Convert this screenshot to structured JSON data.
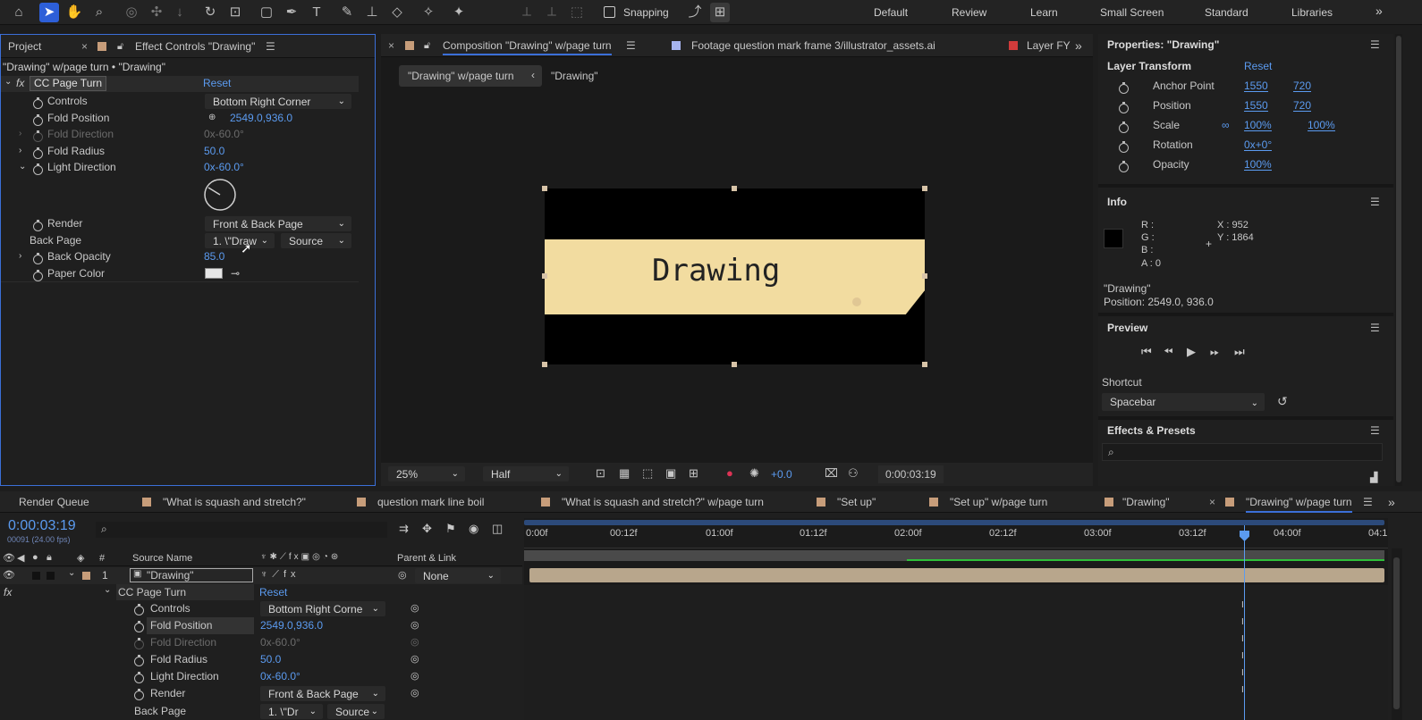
{
  "toolbar": {
    "snapping": "Snapping",
    "workspaces": [
      "Default",
      "Review",
      "Learn",
      "Small Screen",
      "Standard",
      "Libraries"
    ],
    "more": "»"
  },
  "left_panel": {
    "tab_project": "Project",
    "tab_effect": "Effect Controls \"Drawing\"",
    "breadcrumb": "\"Drawing\" w/page turn • \"Drawing\"",
    "fx": "fx",
    "effect_name": "CC Page Turn",
    "reset": "Reset",
    "rows": [
      {
        "label": "Controls",
        "value": "Bottom Right Corner",
        "kind": "dropdown"
      },
      {
        "label": "Fold Position",
        "value": "2549.0,936.0",
        "kind": "point"
      },
      {
        "label": "Fold Direction",
        "value": "0x-60.0°",
        "kind": "disabled"
      },
      {
        "label": "Fold Radius",
        "value": "50.0",
        "kind": "value"
      },
      {
        "label": "Light Direction",
        "value": "0x-60.0°",
        "kind": "value"
      },
      {
        "label": "Render",
        "value": "Front & Back Page",
        "kind": "dropdown"
      },
      {
        "label": "Back Page",
        "value": "1. \\\"Draw",
        "value2": "Source",
        "kind": "dual"
      },
      {
        "label": "Back Opacity",
        "value": "85.0",
        "kind": "value"
      },
      {
        "label": "Paper Color",
        "value": "",
        "kind": "color"
      }
    ]
  },
  "comp": {
    "tab_comp": "Composition \"Drawing\" w/page turn",
    "tab_footage": "Footage question mark frame 3/illustrator_assets.ai",
    "tab_layer": "Layer FY",
    "crumb1": "\"Drawing\" w/page turn",
    "crumb2": "\"Drawing\"",
    "paper_text": "Drawing",
    "zoom": "25%",
    "resolution": "Half",
    "exposure": "+0.0",
    "timecode": "0:00:03:19"
  },
  "right_panel": {
    "title": "Properties: \"Drawing\"",
    "section": "Layer Transform",
    "reset": "Reset",
    "props": [
      {
        "label": "Anchor Point",
        "v1": "1550",
        "v2": "720"
      },
      {
        "label": "Position",
        "v1": "1550",
        "v2": "720"
      },
      {
        "label": "Scale",
        "v1": "100%",
        "v2": "100%"
      },
      {
        "label": "Rotation",
        "v1": "0x+0°",
        "v2": ""
      },
      {
        "label": "Opacity",
        "v1": "100%",
        "v2": ""
      }
    ],
    "info_title": "Info",
    "info_r": "R :",
    "info_g": "G :",
    "info_b": "B :",
    "info_a": "A : 0",
    "info_x": "X : 952",
    "info_y": "Y : 1864",
    "info_layer": "\"Drawing\"",
    "info_pos": "Position: 2549.0, 936.0",
    "preview_title": "Preview",
    "shortcut_label": "Shortcut",
    "shortcut_value": "Spacebar",
    "effects_title": "Effects & Presets"
  },
  "timeline": {
    "tabs": [
      "Render Queue",
      "\"What is squash and stretch?\"",
      "question mark line boil",
      "\"What is squash and stretch?\" w/page turn",
      "\"Set up\"",
      "\"Set up\" w/page turn",
      "\"Drawing\"",
      "\"Drawing\" w/page turn"
    ],
    "timecode": "0:00:03:19",
    "fps": "00091 (24.00 fps)",
    "col_source": "Source Name",
    "col_parent": "Parent & Link",
    "col_hash": "#",
    "layer_num": "1",
    "layer_name": "\"Drawing\"",
    "parent": "None",
    "fx": "fx",
    "effect": "CC Page Turn",
    "reset": "Reset",
    "rows": [
      {
        "label": "Controls",
        "value": "Bottom Right Corne",
        "kind": "dropdown"
      },
      {
        "label": "Fold Position",
        "value": "2549.0,936.0",
        "kind": "value"
      },
      {
        "label": "Fold Direction",
        "value": "0x-60.0°",
        "kind": "disabled"
      },
      {
        "label": "Fold Radius",
        "value": "50.0",
        "kind": "value"
      },
      {
        "label": "Light Direction",
        "value": "0x-60.0°",
        "kind": "value"
      },
      {
        "label": "Render",
        "value": "Front & Back Page",
        "kind": "dropdown"
      },
      {
        "label": "Back Page",
        "value": "1. \\\"Dr",
        "kind": "dropdown"
      }
    ],
    "ruler": [
      "0:00f",
      "00:12f",
      "01:00f",
      "01:12f",
      "02:00f",
      "02:12f",
      "03:00f",
      "03:12f",
      "04:00f",
      "04:1"
    ]
  }
}
